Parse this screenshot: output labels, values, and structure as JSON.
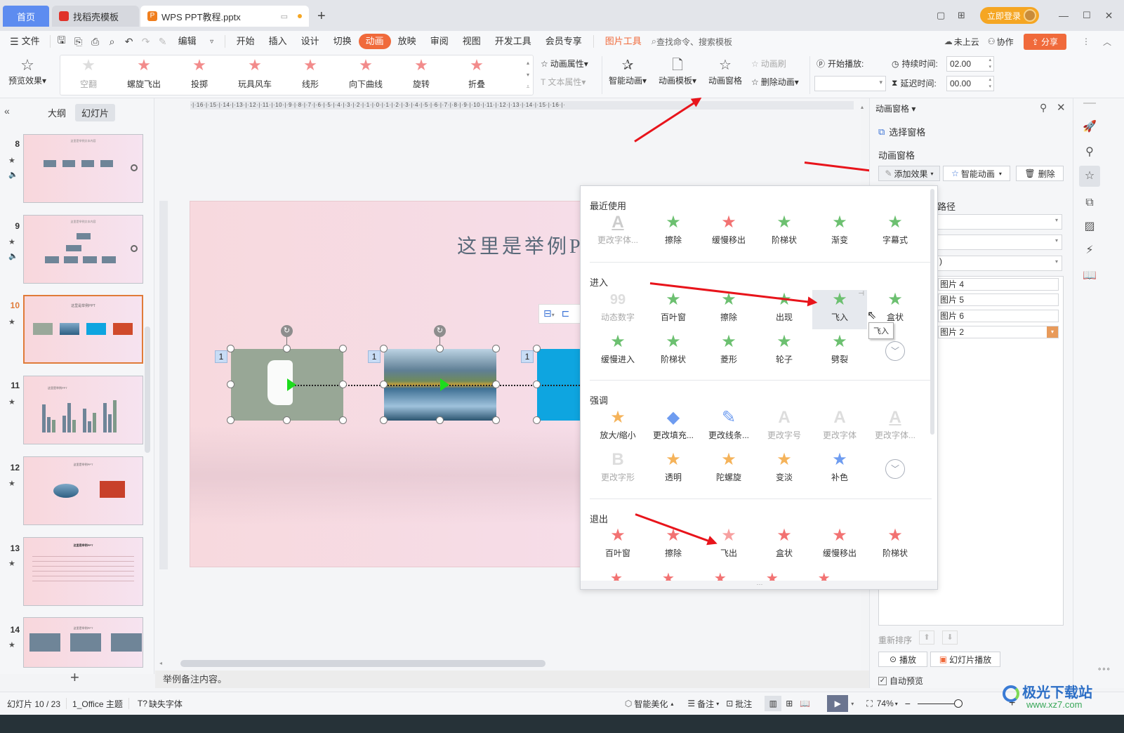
{
  "titlebar": {
    "tabs": [
      {
        "label": "首页"
      },
      {
        "label": "找稻壳模板"
      },
      {
        "label": "WPS PPT教程.pptx"
      }
    ],
    "new_tab": "+",
    "login_label": "立即登录",
    "window_controls": [
      "minimize",
      "maximize",
      "close"
    ]
  },
  "menubar": {
    "file_label": "文件",
    "edit_label": "编辑",
    "items": [
      "开始",
      "插入",
      "设计",
      "切换",
      "动画",
      "放映",
      "审阅",
      "视图",
      "开发工具",
      "会员专享"
    ],
    "active": "动画",
    "context_tab": "图片工具",
    "search_placeholder": "查找命令、搜索模板",
    "cloud_label": "未上云",
    "collab_label": "协作",
    "share_label": "分享",
    "context_color": "#f06a3b"
  },
  "ribbon": {
    "preview_label": "预览效果",
    "gallery": [
      "空翻",
      "螺旋飞出",
      "投掷",
      "玩具风车",
      "线形",
      "向下曲线",
      "旋转",
      "折叠"
    ],
    "anim_props": "动画属性",
    "text_props": "文本属性",
    "smart_anim": "智能动画",
    "anim_template": "动画模板",
    "anim_pane": "动画窗格",
    "anim_brush": "动画刷",
    "delete_anim": "删除动画",
    "start_play": "开始播放:",
    "start_value": "",
    "duration_label": "持续时间:",
    "duration_value": "02.00",
    "delay_label": "延迟时间:",
    "delay_value": "00.00"
  },
  "leftpane": {
    "tab_outline": "大纲",
    "tab_slides": "幻灯片",
    "active_tab": "幻灯片",
    "slides": [
      {
        "num": "8",
        "title": "这里是举例文本内容",
        "has_anim": true,
        "has_audio": true
      },
      {
        "num": "9",
        "title": "这里是举例文本内容",
        "has_anim": true,
        "has_audio": true
      },
      {
        "num": "10",
        "title": "这里是举例PPT",
        "has_anim": true,
        "selected": true
      },
      {
        "num": "11",
        "title": "这里是举例PPT",
        "has_anim": true
      },
      {
        "num": "12",
        "title": "这里是举例PPT",
        "has_anim": true
      },
      {
        "num": "13",
        "title": "这里是举例PPT",
        "has_anim": true
      },
      {
        "num": "14",
        "title": "这里是举例PPT",
        "has_anim": true
      }
    ],
    "add_label": "+"
  },
  "slide": {
    "title": "这里是举例PPT",
    "order_tags": [
      "1",
      "1",
      "1"
    ]
  },
  "ruler": {
    "h": "·|·16·|·15·|·14·|·13·|·12·|·11·|·10·|·9·|·8·|·7·|·6·|·5·|·4·|·3·|·2·|·1·|·0·|·1·|·2·|·3·|·4·|·5·|·6·|·7·|·8·|·9·|·10·|·11·|·12·|·13·|·14·|·15·|·16·|·"
  },
  "dropdown": {
    "sections": [
      {
        "title": "最近使用",
        "items": [
          {
            "label": "更改字体...",
            "icon": "A",
            "disabled": true
          },
          {
            "label": "擦除",
            "icon": "★"
          },
          {
            "label": "缓慢移出",
            "icon": "★"
          },
          {
            "label": "阶梯状",
            "icon": "★"
          },
          {
            "label": "渐变",
            "icon": "★"
          },
          {
            "label": "字幕式",
            "icon": "★"
          }
        ]
      },
      {
        "title": "进入",
        "items": [
          {
            "label": "动态数字",
            "icon": "99",
            "disabled": true
          },
          {
            "label": "百叶窗",
            "icon": "★"
          },
          {
            "label": "擦除",
            "icon": "★"
          },
          {
            "label": "出现",
            "icon": "★"
          },
          {
            "label": "飞入",
            "icon": "★",
            "hover": true
          },
          {
            "label": "盒状",
            "icon": "★"
          },
          {
            "label": "缓慢进入",
            "icon": "★"
          },
          {
            "label": "阶梯状",
            "icon": "★"
          },
          {
            "label": "菱形",
            "icon": "★"
          },
          {
            "label": "轮子",
            "icon": "★"
          },
          {
            "label": "劈裂",
            "icon": "★"
          }
        ]
      },
      {
        "title": "强调",
        "items": [
          {
            "label": "放大/缩小",
            "icon": "★"
          },
          {
            "label": "更改填充...",
            "icon": "◆"
          },
          {
            "label": "更改线条...",
            "icon": "✎"
          },
          {
            "label": "更改字号",
            "icon": "A",
            "disabled": true
          },
          {
            "label": "更改字体",
            "icon": "A",
            "disabled": true
          },
          {
            "label": "更改字体...",
            "icon": "A",
            "disabled": true
          },
          {
            "label": "更改字形",
            "icon": "B",
            "disabled": true
          },
          {
            "label": "透明",
            "icon": "★"
          },
          {
            "label": "陀螺旋",
            "icon": "★"
          },
          {
            "label": "变淡",
            "icon": "★"
          },
          {
            "label": "补色",
            "icon": "★"
          }
        ]
      },
      {
        "title": "退出",
        "items": [
          {
            "label": "百叶窗",
            "icon": "★"
          },
          {
            "label": "擦除",
            "icon": "★"
          },
          {
            "label": "飞出",
            "icon": "★"
          },
          {
            "label": "盒状",
            "icon": "★"
          },
          {
            "label": "缓慢移出",
            "icon": "★"
          },
          {
            "label": "阶梯状",
            "icon": "★"
          }
        ]
      }
    ],
    "tooltip": "飞入",
    "colors": {
      "entry": "#6cc070",
      "emphasis": "#f5b35a",
      "exit": "#f27272",
      "recent_exit": "#f27272"
    }
  },
  "rpanel": {
    "title": "动画窗格",
    "select_pane": "选择窗格",
    "section_label": "动画窗格",
    "add_effect": "添加效果",
    "smart_anim": "智能动画",
    "delete": "删除",
    "path_label_partial": "路径",
    "select3_partial": ")",
    "list_items": [
      "图片 4",
      "图片 5",
      "图片 6",
      "图片 2"
    ],
    "reorder_label": "重新排序",
    "play_label": "播放",
    "slideshow_label": "幻灯片播放",
    "autopreview_label": "自动预览",
    "autopreview_checked": true
  },
  "notes": {
    "text": "举例备注内容。"
  },
  "status": {
    "slide_info": "幻灯片 10 / 23",
    "theme": "1_Office 主题",
    "missing_font": "缺失字体",
    "beautify": "智能美化",
    "notes": "备注",
    "comments": "批注",
    "zoom": "74%"
  },
  "watermark": {
    "cn": "极光下载站",
    "url": "www.xz7.com"
  }
}
